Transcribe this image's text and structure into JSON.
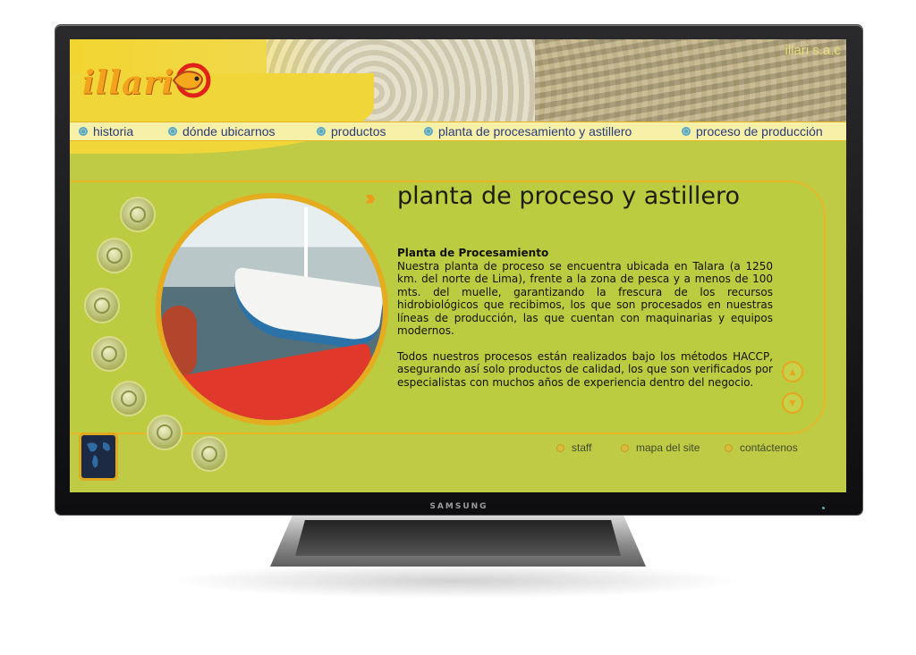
{
  "monitor": {
    "brand": "SAMSUNG"
  },
  "header": {
    "logo": "illari",
    "company": "illari s.a.c"
  },
  "nav": {
    "items": [
      {
        "label": "historia"
      },
      {
        "label": "dónde ubicarnos"
      },
      {
        "label": "productos"
      },
      {
        "label": "planta de procesamiento y astillero"
      },
      {
        "label": "proceso de producción"
      }
    ]
  },
  "main": {
    "heading": "planta de proceso y astillero",
    "subheading": "Planta de Procesamiento",
    "paragraph1": "Nuestra planta de proceso se encuentra ubicada en Talara (a 1250 km. del norte de Lima), frente a la zona de pesca y a menos de 100 mts. del muelle, garantizando la frescura de los recursos hidrobiológicos que recibimos, los que son procesados en nuestras líneas de producción, las que cuentan con maquinarias y equipos modernos.",
    "paragraph2": "Todos nuestros procesos están realizados bajo los métodos HACCP, asegurando así solo productos de calidad, los que son verificados por especialistas con muchos años de experiencia dentro del negocio."
  },
  "footer": {
    "links": [
      {
        "label": "staff"
      },
      {
        "label": "mapa del site"
      },
      {
        "label": "contáctenos"
      }
    ]
  },
  "colors": {
    "accent": "#e4ac1e",
    "background": "#c0cb45",
    "nav_text": "#2b3a7a"
  }
}
